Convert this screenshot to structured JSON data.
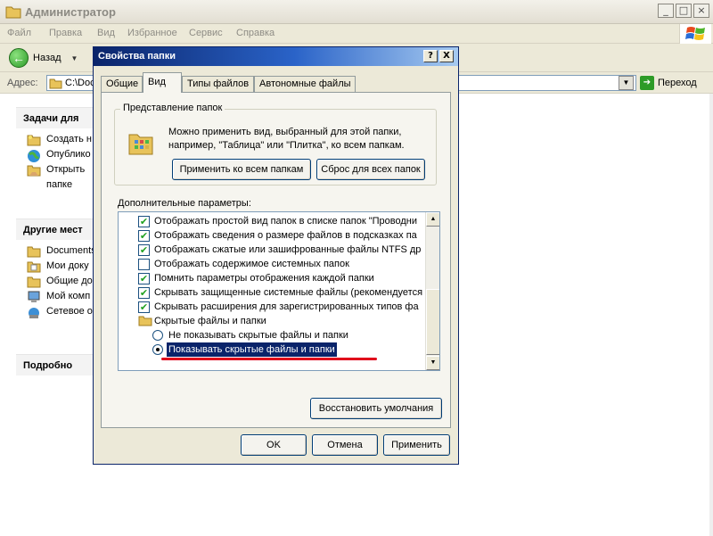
{
  "window": {
    "title": "Администратор",
    "menu": [
      "Файл",
      "Правка",
      "Вид",
      "Избранное",
      "Сервис",
      "Справка"
    ],
    "back_label": "Назад",
    "address_label": "Адрес:",
    "address_value": "C:\\Doc",
    "go_label": "Переход"
  },
  "taskpane": {
    "tasks_title": "Задачи для",
    "tasks": [
      "Создать н",
      "Опублико",
      "Открыть",
      "папке"
    ],
    "other_title": "Другие мест",
    "other": [
      "Documents",
      "Мои доку",
      "Общие до",
      "Мой комп",
      "Сетевое о"
    ],
    "details_title": "Подробно"
  },
  "dialog": {
    "title": "Свойства папки",
    "help_btn": "?",
    "close_btn": "X",
    "tabs": [
      "Общие",
      "Вид",
      "Типы файлов",
      "Автономные файлы"
    ],
    "active_tab": "Вид",
    "group_title": "Представление папок",
    "group_text": "Можно применить вид, выбранный для этой папки, например, \"Таблица\" или \"Плитка\", ко всем папкам.",
    "apply_all_btn": "Применить ко всем папкам",
    "reset_all_btn": "Сброс для всех папок",
    "advanced_label": "Дополнительные параметры:",
    "options": [
      {
        "label": "Отображать простой вид папок в списке папок \"Проводни",
        "checked": true
      },
      {
        "label": "Отображать сведения о размере файлов в подсказках па",
        "checked": true
      },
      {
        "label": "Отображать сжатые или зашифрованные файлы NTFS др",
        "checked": true
      },
      {
        "label": "Отображать содержимое системных папок",
        "checked": false
      },
      {
        "label": "Помнить параметры отображения каждой папки",
        "checked": true
      },
      {
        "label": "Скрывать защищенные системные файлы (рекомендуется",
        "checked": true
      },
      {
        "label": "Скрывать расширения для зарегистрированных типов фа",
        "checked": true
      }
    ],
    "hidden_group": "Скрытые файлы и папки",
    "radio_options": [
      {
        "label": "Не показывать скрытые файлы и папки",
        "selected": false
      },
      {
        "label": "Показывать скрытые файлы и папки",
        "selected": true
      }
    ],
    "restore_btn": "Восстановить умолчания",
    "ok_btn": "OK",
    "cancel_btn": "Отмена",
    "apply_btn": "Применить"
  },
  "colors": {
    "titlebar_active": "#0a246a",
    "selection": "#0a246a",
    "annotation_red": "#e0001a",
    "check_green": "#21a121"
  }
}
